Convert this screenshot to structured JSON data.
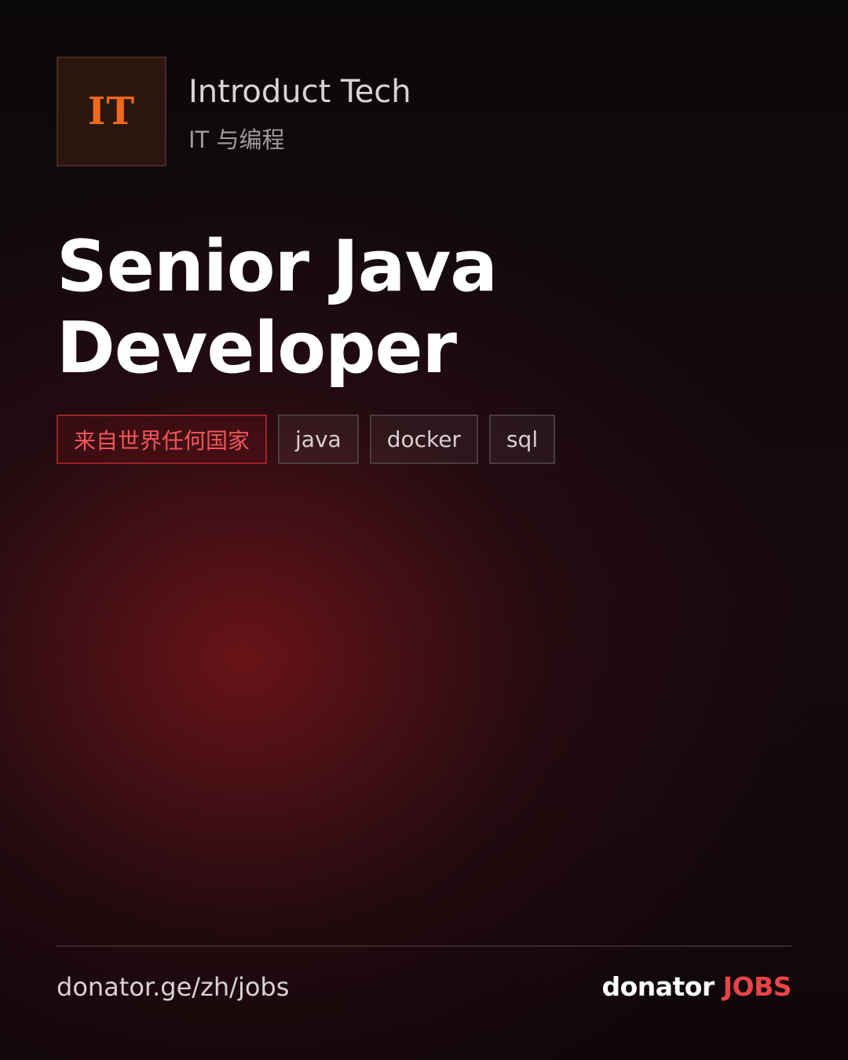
{
  "company": {
    "logo_text": "IT",
    "name": "Introduct Tech",
    "category": "IT 与编程"
  },
  "job": {
    "title": "Senior Java Developer"
  },
  "tags": [
    {
      "label": "来自世界任何国家",
      "kind": "location"
    },
    {
      "label": "java",
      "kind": "skill"
    },
    {
      "label": "docker",
      "kind": "skill"
    },
    {
      "label": "sql",
      "kind": "skill"
    }
  ],
  "footer": {
    "url": "donator.ge/zh/jobs",
    "brand_main": "donator",
    "brand_accent": "JOBS"
  },
  "colors": {
    "logo_accent": "#f06a1e",
    "brand_accent": "#e84448",
    "location_tag": "#f0555a",
    "background": "#0b0708"
  }
}
